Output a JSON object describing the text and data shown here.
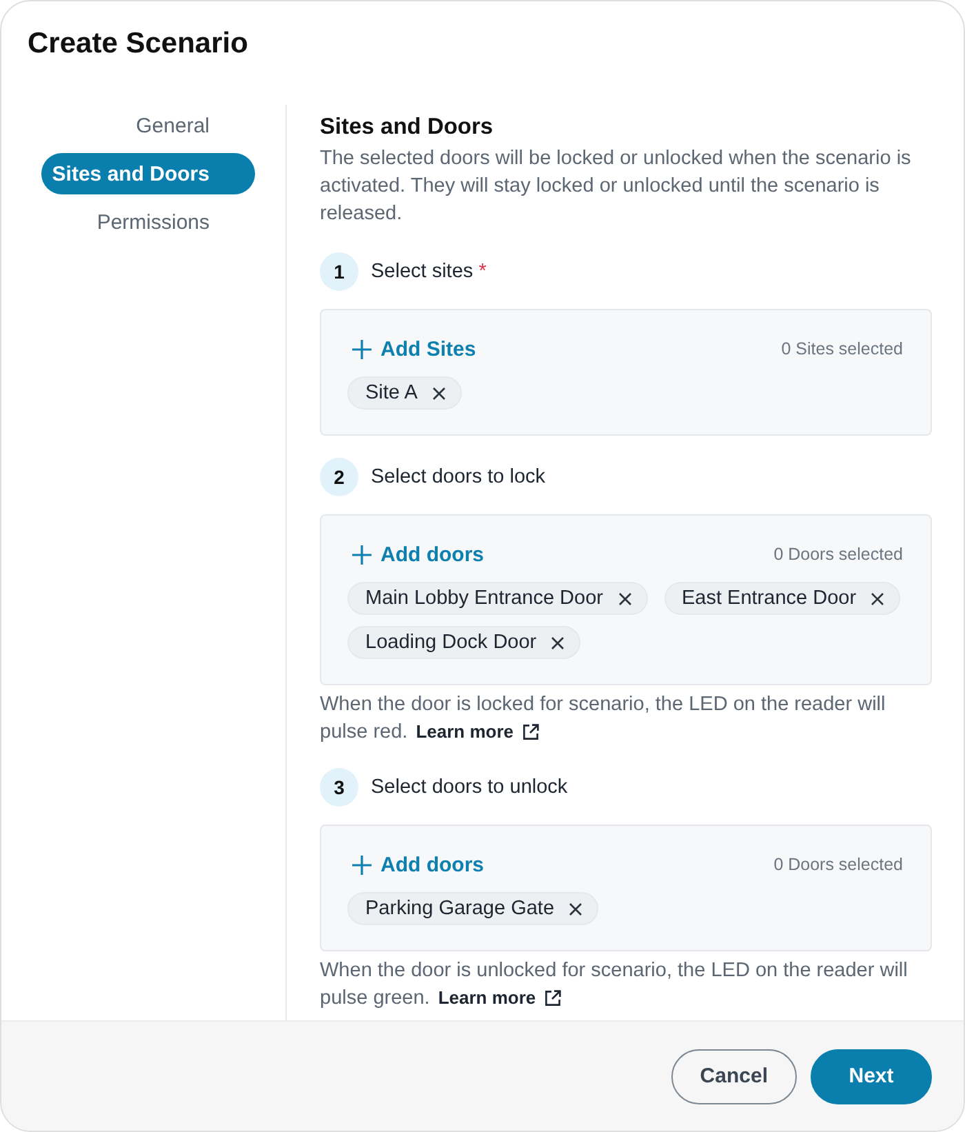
{
  "dialog": {
    "title": "Create Scenario"
  },
  "nav": {
    "items": [
      {
        "label": "General",
        "selected": false
      },
      {
        "label": "Sites and Doors",
        "selected": true
      },
      {
        "label": "Permissions",
        "selected": false
      }
    ]
  },
  "section": {
    "heading": "Sites and Doors",
    "description": "The selected doors will be locked or unlocked when the scenario is activated. They will stay locked or unlocked until the scenario is released."
  },
  "steps": [
    {
      "number": "1",
      "label": "Select sites",
      "required_mark": "*",
      "add_label": "Add Sites",
      "count": "0 Sites selected",
      "chips": [
        "Site A"
      ]
    },
    {
      "number": "2",
      "label": "Select doors to lock",
      "add_label": "Add doors",
      "count": "0 Doors selected",
      "chips": [
        "Main Lobby Entrance Door",
        "East Entrance Door",
        "Loading Dock Door"
      ],
      "hint": {
        "text": "When the door is locked for scenario, the LED on the reader will pulse red.",
        "link": "Learn more"
      }
    },
    {
      "number": "3",
      "label": "Select doors to unlock",
      "add_label": "Add doors",
      "count": "0 Doors selected",
      "chips": [
        "Parking Garage Gate"
      ],
      "hint": {
        "text": "When the door is unlocked for scenario, the LED on the reader will pulse green.",
        "link": "Learn more"
      }
    }
  ],
  "footer": {
    "buttons": [
      {
        "label": "Cancel",
        "kind": "secondary"
      },
      {
        "label": "Next",
        "kind": "primary"
      }
    ]
  }
}
